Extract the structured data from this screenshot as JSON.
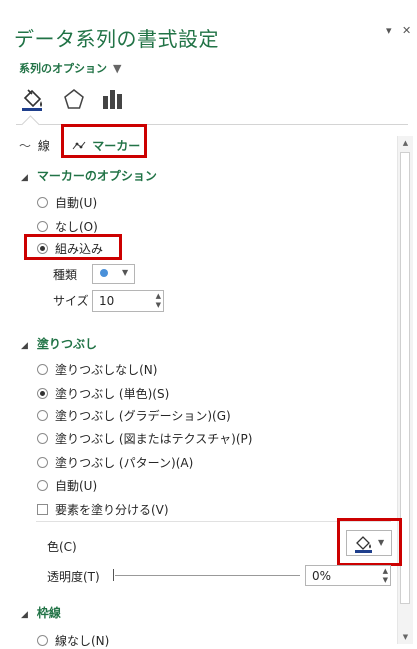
{
  "pane": {
    "title": "データ系列の書式設定",
    "pin_glyph": "▾",
    "close_glyph": "✕"
  },
  "options_dropdown": {
    "label": "系列のオプション",
    "caret": "▼"
  },
  "icon_tabs": [
    {
      "name": "fill-line-icon"
    },
    {
      "name": "effects-pentagon-icon"
    },
    {
      "name": "series-options-bar-icon"
    }
  ],
  "subtabs": {
    "line": "線",
    "marker": "マーカー"
  },
  "marker_options": {
    "header": "マーカーのオプション",
    "auto": "自動(U)",
    "none": "なし(O)",
    "builtin": "組み込み",
    "type_label": "種類",
    "size_label": "サイズ",
    "size_value": "10"
  },
  "fill": {
    "header": "塗りつぶし",
    "options": [
      {
        "label": "塗りつぶしなし(N)",
        "selected": false
      },
      {
        "label": "塗りつぶし (単色)(S)",
        "selected": true
      },
      {
        "label": "塗りつぶし (グラデーション)(G)",
        "selected": false
      },
      {
        "label": "塗りつぶし (図またはテクスチャ)(P)",
        "selected": false
      },
      {
        "label": "塗りつぶし (パターン)(A)",
        "selected": false
      },
      {
        "label": "自動(U)",
        "selected": false
      }
    ],
    "vary_colors": "要素を塗り分ける(V)",
    "color_label": "色(C)",
    "transparency_label": "透明度(T)",
    "transparency_value": "0%"
  },
  "border": {
    "header": "枠線",
    "none_label": "線なし(N)"
  },
  "colors": {
    "accent": "#217346",
    "highlight": "#cc0000",
    "marker_color": "#4a90d9",
    "fill_color": "#1f3f8c"
  }
}
